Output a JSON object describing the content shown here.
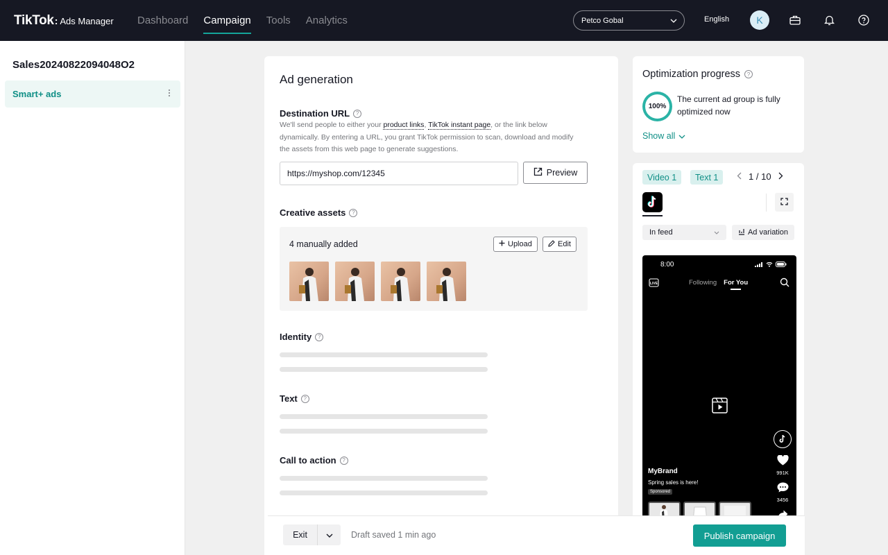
{
  "topbar": {
    "logo_main": "TikTok",
    "logo_sub": "Ads Manager",
    "nav": [
      {
        "label": "Dashboard",
        "active": false
      },
      {
        "label": "Campaign",
        "active": true
      },
      {
        "label": "Tools",
        "active": false
      },
      {
        "label": "Analytics",
        "active": false
      }
    ],
    "account": "Petco Gobal",
    "language": "English",
    "avatar_initial": "K",
    "icons": [
      "briefcase-icon",
      "bell-icon",
      "help-icon"
    ]
  },
  "sidebar": {
    "campaign_name": "Sales20240822094048O2",
    "items": [
      {
        "label": "Smart+ ads"
      }
    ]
  },
  "main": {
    "title": "Ad generation",
    "destination": {
      "label": "Destination URL",
      "desc_1": "We'll send people to either your ",
      "link_product": "product links",
      "desc_2": ", ",
      "link_instant": "TikTok instant page",
      "desc_3": ", or the link below dynamically. By entering a URL, you grant TikTok permission to scan, download and modify the assets from this web page to generate suggestions.",
      "url_value": "https://myshop.com/12345",
      "preview_label": "Preview"
    },
    "creative": {
      "label": "Creative assets",
      "count_text": "4 manually added",
      "upload_label": "Upload",
      "edit_label": "Edit"
    },
    "identity_label": "Identity",
    "text_label": "Text",
    "cta_label": "Call to action"
  },
  "footer": {
    "exit_label": "Exit",
    "draft_status": "Draft saved 1 min ago",
    "publish_label": "Publish campaign"
  },
  "optimization": {
    "title": "Optimization progress",
    "percent_text": "100%",
    "percent_value": 100,
    "message": "The current ad group is fully optimized now",
    "show_all": "Show all"
  },
  "preview": {
    "chip_video": "Video 1",
    "chip_text": "Text 1",
    "page_current": "1",
    "page_sep": "/",
    "page_total": "10",
    "placement": "In feed",
    "variation_label": "Ad variation",
    "phone": {
      "time": "8:00",
      "tab_following": "Following",
      "tab_foryou": "For You",
      "likes": "991K",
      "comments": "3456",
      "brand": "MyBrand",
      "caption": "Spring sales is here!",
      "sponsored": "Sponsored"
    }
  },
  "colors": {
    "accent": "#129e93",
    "topbar": "#161823",
    "chip_bg": "#d9f0ee"
  }
}
